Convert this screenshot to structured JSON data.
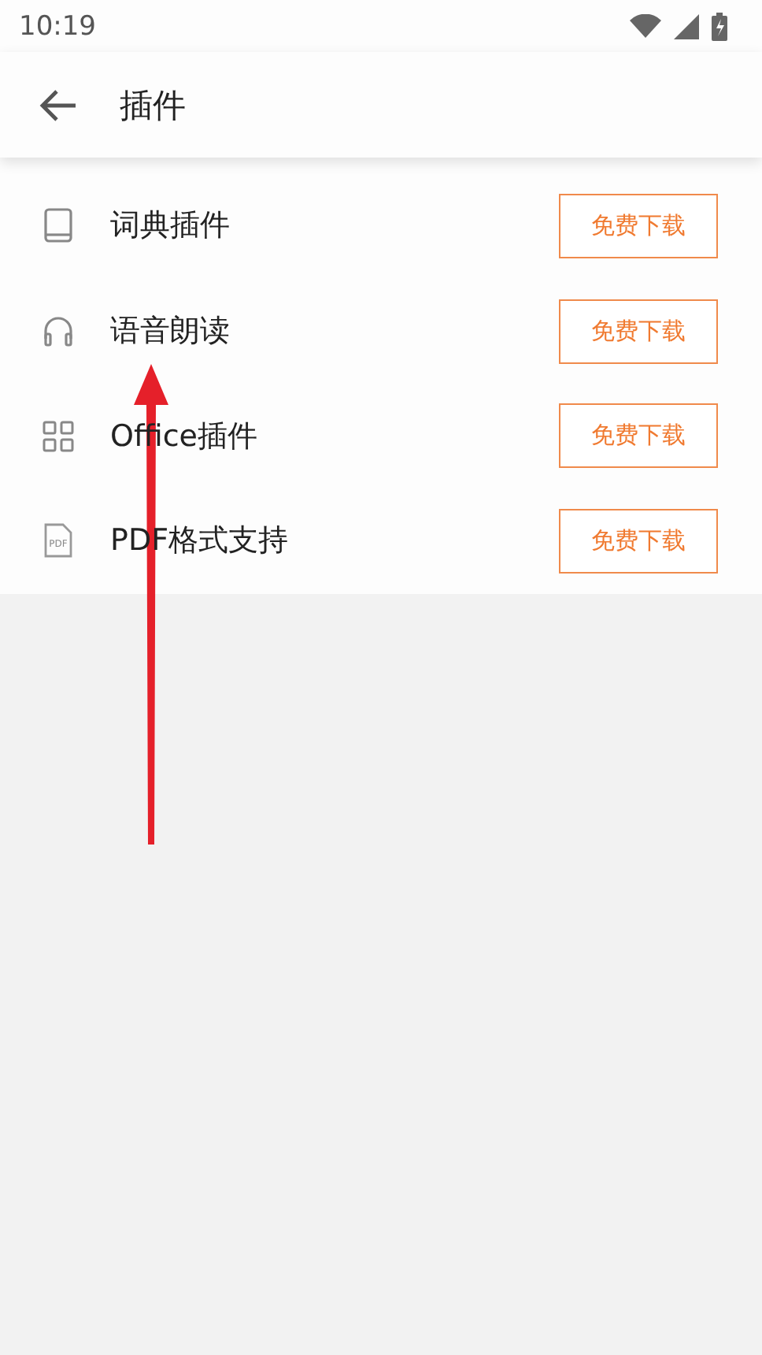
{
  "status_bar": {
    "time": "10:19"
  },
  "header": {
    "title": "插件"
  },
  "plugins": [
    {
      "kind": "book",
      "name": "词典插件",
      "action": "免费下载"
    },
    {
      "kind": "headphones",
      "name": "语音朗读",
      "action": "免费下载"
    },
    {
      "kind": "grid",
      "name": "Office插件",
      "action": "免费下载"
    },
    {
      "kind": "pdf",
      "icon_label": "PDF",
      "name": "PDF格式支持",
      "action": "免费下载"
    }
  ]
}
